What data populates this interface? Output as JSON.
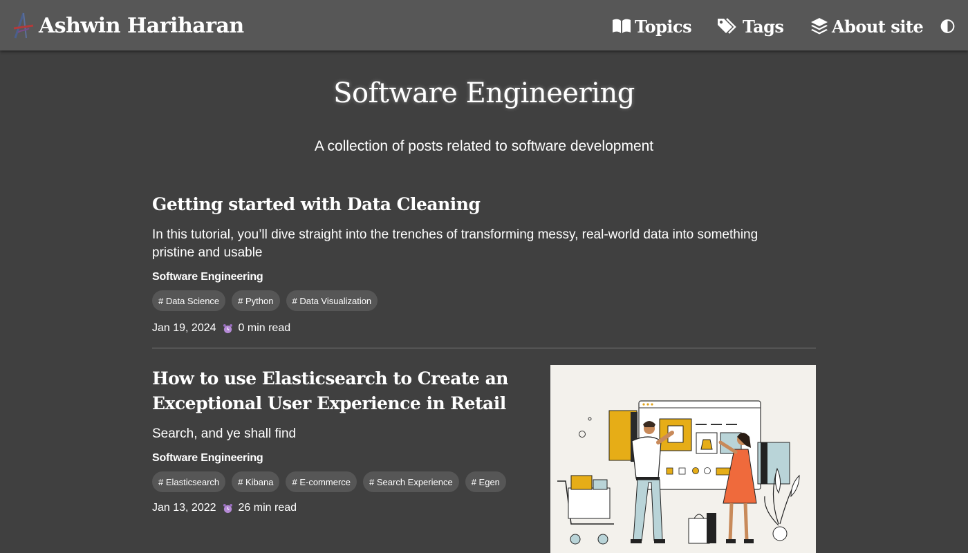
{
  "site": {
    "name": "Ashwin Hariharan"
  },
  "nav": {
    "topics": "Topics",
    "tags": "Tags",
    "about": "About site"
  },
  "header": {
    "title": "Software Engineering",
    "subtitle": "A collection of posts related to software development"
  },
  "posts": [
    {
      "title": "Getting started with Data Cleaning",
      "summary": "In this tutorial, you’ll dive straight into the trenches of transforming messy, real-world data into something pristine and usable",
      "topic": "Software Engineering",
      "tags": [
        "# Data Science",
        "# Python",
        "# Data Visualization"
      ],
      "date": "Jan 19, 2024",
      "read_time": "0 min read"
    },
    {
      "title_line1": "How to use Elasticsearch to Create an",
      "title_line2": "Exceptional User Experience in Retail",
      "summary": "Search, and ye shall find",
      "topic": "Software Engineering",
      "tags": [
        "# Elasticsearch",
        "# Kibana",
        "# E-commerce",
        "# Search Experience",
        "# Egen"
      ],
      "date": "Jan 13, 2022",
      "read_time": "26 min read"
    }
  ],
  "icons": {
    "topics": "open-book-icon",
    "tags": "tags-icon",
    "about": "layers-icon",
    "theme": "half-circle-contrast-icon",
    "read_time": "alarm-clock-icon"
  },
  "colors": {
    "background": "#404040",
    "navbar": "#575757",
    "tag_background": "#565656",
    "clock": "#b58ad6"
  }
}
